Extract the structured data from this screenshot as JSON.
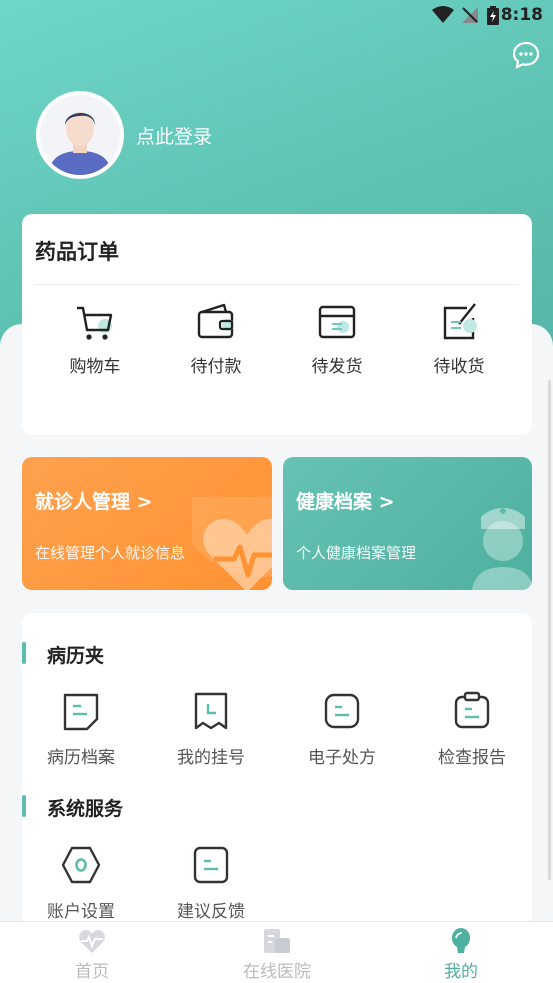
{
  "status": {
    "time": "8:18"
  },
  "profile": {
    "login_text": "点此登录"
  },
  "orders": {
    "title": "药品订单",
    "items": [
      {
        "label": "购物车",
        "icon": "cart-icon"
      },
      {
        "label": "待付款",
        "icon": "wallet-icon"
      },
      {
        "label": "待发货",
        "icon": "box-icon"
      },
      {
        "label": "待收货",
        "icon": "receive-icon"
      }
    ]
  },
  "promos": {
    "patient": {
      "title": "就诊人管理 >",
      "subtitle": "在线管理个人就诊信息"
    },
    "health": {
      "title": "健康档案 >",
      "subtitle": "个人健康档案管理"
    }
  },
  "records": {
    "title": "病历夹",
    "items": [
      {
        "label": "病历档案",
        "icon": "medical-record-icon"
      },
      {
        "label": "我的挂号",
        "icon": "registration-icon"
      },
      {
        "label": "电子处方",
        "icon": "prescription-icon"
      },
      {
        "label": "检查报告",
        "icon": "report-icon"
      }
    ]
  },
  "services": {
    "title": "系统服务",
    "items": [
      {
        "label": "账户设置",
        "icon": "settings-icon"
      },
      {
        "label": "建议反馈",
        "icon": "feedback-icon"
      }
    ]
  },
  "tabs": [
    {
      "label": "首页",
      "icon": "heartbeat-icon"
    },
    {
      "label": "在线医院",
      "icon": "hospital-icon"
    },
    {
      "label": "我的",
      "icon": "profile-icon"
    }
  ],
  "colors": {
    "accent": "#4fb0a0",
    "orange": "#ff9233",
    "teal": "#5fc3b3"
  }
}
